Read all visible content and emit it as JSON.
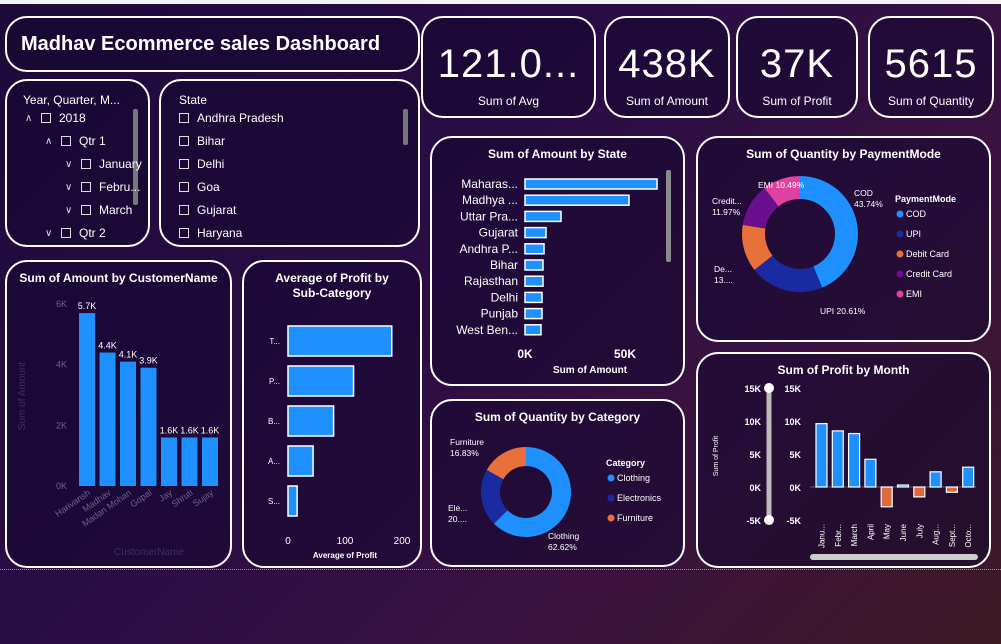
{
  "title": "Madhav Ecommerce sales Dashboard",
  "colors": {
    "blue": "#1e90ff",
    "navy": "#1a2aa0",
    "orange": "#e8703a",
    "purple": "#6a0f8e",
    "pink": "#e040a0",
    "red": "#e06a40"
  },
  "kpis": [
    {
      "value": "121.0...",
      "label": "Sum of Avg"
    },
    {
      "value": "438K",
      "label": "Sum of Amount"
    },
    {
      "value": "37K",
      "label": "Sum of Profit"
    },
    {
      "value": "5615",
      "label": "Sum of Quantity"
    }
  ],
  "date_slicer": {
    "title": "Year, Quarter, M...",
    "items": [
      {
        "label": "2018",
        "level": 0,
        "icon": "chevron-up-icon"
      },
      {
        "label": "Qtr 1",
        "level": 1,
        "icon": "chevron-up-icon"
      },
      {
        "label": "January",
        "level": 2,
        "icon": "chevron-down-icon"
      },
      {
        "label": "Febru...",
        "level": 2,
        "icon": "chevron-down-icon"
      },
      {
        "label": "March",
        "level": 2,
        "icon": "chevron-down-icon"
      },
      {
        "label": "Qtr 2",
        "level": 1,
        "icon": "chevron-down-icon"
      }
    ]
  },
  "state_slicer": {
    "title": "State",
    "items": [
      "Andhra Pradesh",
      "Bihar",
      "Delhi",
      "Goa",
      "Gujarat",
      "Haryana"
    ]
  },
  "chart_data": [
    {
      "id": "amount_by_customer",
      "type": "bar",
      "title": "Sum of Amount by CustomerName",
      "xlabel": "CustomerName",
      "ylabel": "Sum of Amount",
      "categories": [
        "Harivansh",
        "Madhav",
        "Madan Mohan",
        "Gopal",
        "Jay",
        "Shruti",
        "Sujay"
      ],
      "values": [
        5700,
        4400,
        4100,
        3900,
        1600,
        1600,
        1600
      ],
      "data_labels": [
        "5.7K",
        "4.4K",
        "4.1K",
        "3.9K",
        "1.6K",
        "1.6K",
        "1.6K"
      ],
      "yticks": [
        "0K",
        "2K",
        "4K",
        "6K"
      ],
      "ylim": [
        0,
        6000
      ]
    },
    {
      "id": "profit_by_subcategory",
      "type": "bar",
      "title": "Average of Profit by Sub-Category",
      "xlabel": "Average of Profit",
      "categories": [
        "T...",
        "P...",
        "B...",
        "A...",
        "S..."
      ],
      "values": [
        182,
        115,
        80,
        44,
        16
      ],
      "xticks": [
        "0",
        "100",
        "200"
      ],
      "xlim": [
        0,
        200
      ]
    },
    {
      "id": "amount_by_state",
      "type": "bar",
      "title": "Sum of Amount by State",
      "xlabel": "Sum of Amount",
      "categories": [
        "Maharas...",
        "Madhya ...",
        "Uttar Pra...",
        "Gujarat",
        "Andhra P...",
        "Bihar",
        "Rajasthan",
        "Delhi",
        "Punjab",
        "West Ben..."
      ],
      "values": [
        66000,
        52000,
        18000,
        10500,
        9500,
        9000,
        9000,
        8500,
        8500,
        8000
      ],
      "xticks": [
        "0K",
        "50K"
      ],
      "xlim": [
        0,
        70000
      ]
    },
    {
      "id": "quantity_by_paymentmode",
      "type": "pie",
      "title": "Sum of Quantity by PaymentMode",
      "legend_title": "PaymentMode",
      "labels": [
        "COD",
        "UPI",
        "Debit Card",
        "Credit Card",
        "EMI"
      ],
      "values": [
        43.74,
        20.61,
        13.13,
        11.97,
        10.49
      ],
      "slice_labels": [
        [
          "COD",
          "43.74%"
        ],
        [
          "UPI 20.61%"
        ],
        [
          "De...",
          "13...."
        ],
        [
          "Credit...",
          "11.97%"
        ],
        [
          "EMI 10.49%"
        ]
      ],
      "colors": [
        "#1e90ff",
        "#1a2aa0",
        "#e8703a",
        "#6a0f8e",
        "#e040a0"
      ],
      "legend": "right"
    },
    {
      "id": "quantity_by_category",
      "type": "pie",
      "title": "Sum of Quantity by Category",
      "legend_title": "Category",
      "labels": [
        "Clothing",
        "Electronics",
        "Furniture"
      ],
      "values": [
        62.62,
        20.55,
        16.83
      ],
      "slice_labels": [
        [
          "Clothing",
          "62.62%"
        ],
        [
          "Ele...",
          "20...."
        ],
        [
          "Furniture",
          "16.83%"
        ]
      ],
      "colors": [
        "#1e90ff",
        "#1a2aa0",
        "#e8703a"
      ],
      "legend": "right"
    },
    {
      "id": "profit_by_month",
      "type": "bar",
      "title": "Sum of Profit by Month",
      "ylabel": "Sum of Profit",
      "categories": [
        "Janu...",
        "Febr...",
        "March",
        "April",
        "May",
        "June",
        "July",
        "Aug...",
        "Sept...",
        "Octo..."
      ],
      "values": [
        9600,
        8500,
        8100,
        4200,
        -3000,
        300,
        -1500,
        2300,
        -800,
        3000
      ],
      "yticks": [
        "-5K",
        "0K",
        "5K",
        "10K",
        "15K"
      ],
      "ylim": [
        -5000,
        15000
      ],
      "slider_ticks": [
        "15K",
        "10K",
        "5K",
        "0K",
        "-5K"
      ]
    }
  ]
}
